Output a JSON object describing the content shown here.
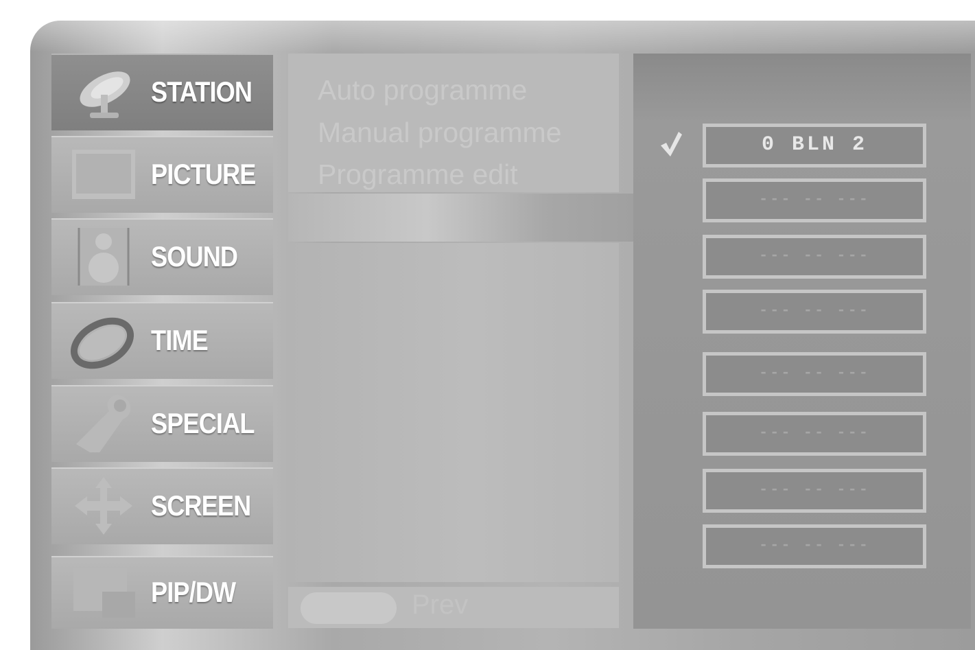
{
  "menu": {
    "items": [
      {
        "label": "STATION",
        "icon": "satellite-dish-icon",
        "active": true
      },
      {
        "label": "PICTURE",
        "icon": "monitor-screen-icon",
        "active": false
      },
      {
        "label": "SOUND",
        "icon": "speaker-icon",
        "active": false
      },
      {
        "label": "TIME",
        "icon": "clock-ring-icon",
        "active": false
      },
      {
        "label": "SPECIAL",
        "icon": "wrench-tool-icon",
        "active": false
      },
      {
        "label": "SCREEN",
        "icon": "four-way-arrows-icon",
        "active": false
      },
      {
        "label": "PIP/DW",
        "icon": "picture-in-picture-icon",
        "active": false
      }
    ]
  },
  "submenu": {
    "items": [
      {
        "label": "Auto programme"
      },
      {
        "label": "Manual programme"
      },
      {
        "label": "Programme edit"
      }
    ]
  },
  "bottom": {
    "text": "Prev"
  },
  "programmes": {
    "selected_marker": "checkmark-icon",
    "items": [
      {
        "label": "0 BLN 2",
        "filled": true
      },
      {
        "label": "--- -- ---",
        "filled": false
      },
      {
        "label": "--- -- ---",
        "filled": false
      },
      {
        "label": "--- -- ---",
        "filled": false
      },
      {
        "label": "--- -- ---",
        "filled": false
      },
      {
        "label": "--- -- ---",
        "filled": false
      },
      {
        "label": "--- -- ---",
        "filled": false
      },
      {
        "label": "--- -- ---",
        "filled": false
      }
    ]
  }
}
